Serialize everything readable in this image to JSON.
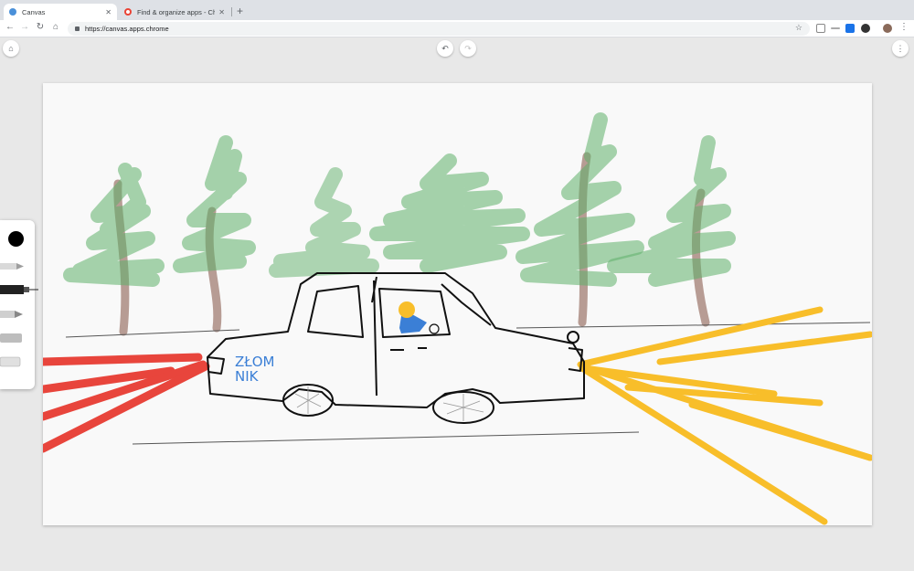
{
  "browser": {
    "tabs": [
      {
        "title": "Canvas",
        "active": true,
        "favicon_color": "#4a90d9"
      },
      {
        "title": "Find & organize apps - Chrome",
        "active": false,
        "favicon_color": "#ea4335"
      }
    ],
    "url": "https://canvas.apps.chrome",
    "icons": [
      "back-icon",
      "forward-icon",
      "reload-icon",
      "home-icon",
      "lock-icon",
      "star-icon"
    ]
  },
  "app": {
    "name": "Canvas",
    "drawing_text": "ZŁOM\nNIK",
    "colors": {
      "selected_color": "#000000",
      "tree_green": "#5fb06a",
      "trunk_brown": "#a6857a",
      "headlight_yellow": "#f8be2a",
      "taillight_red": "#e8453c",
      "text_blue": "#3b7fd6"
    },
    "tools": [
      "pen-tool",
      "marker-tool",
      "pencil-tool",
      "chalk-tool",
      "eraser-tool"
    ]
  }
}
